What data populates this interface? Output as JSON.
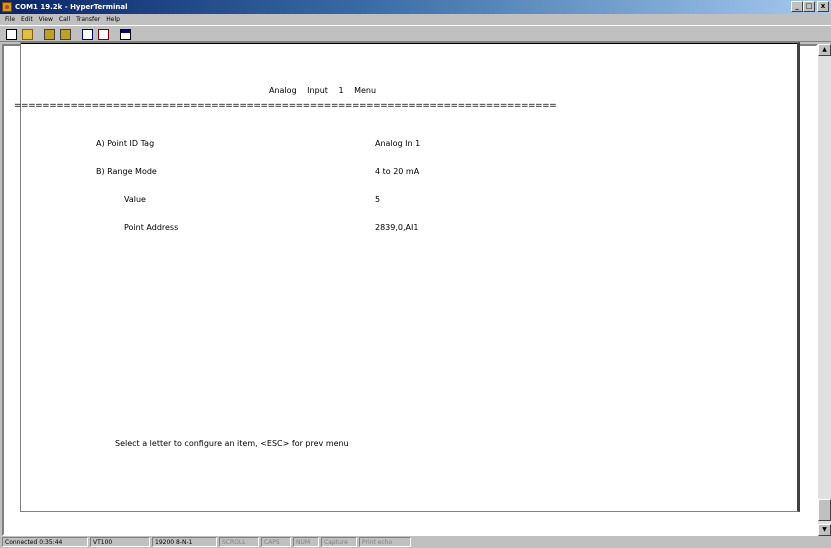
{
  "window": {
    "title": "COM1 19.2k - HyperTerminal",
    "controls": {
      "minimize": "_",
      "maximize": "□",
      "close": "x"
    }
  },
  "menu": {
    "items": [
      {
        "label": "File"
      },
      {
        "label": "Edit"
      },
      {
        "label": "View"
      },
      {
        "label": "Call"
      },
      {
        "label": "Transfer"
      },
      {
        "label": "Help"
      }
    ]
  },
  "toolbar": {
    "buttons": [
      {
        "icon": "new-file-icon"
      },
      {
        "icon": "open-icon"
      },
      {
        "icon": "call-icon"
      },
      {
        "icon": "disconnect-icon"
      },
      {
        "icon": "send-icon"
      },
      {
        "icon": "receive-icon"
      },
      {
        "icon": "properties-icon"
      }
    ]
  },
  "terminal": {
    "menu_title": "Analog Input 1 Menu",
    "rule": "=============================================================================",
    "rows": [
      {
        "label": "A) Point ID Tag",
        "value": "Analog In 1"
      },
      {
        "label": "B) Range Mode",
        "value": "4 to 20 mA"
      },
      {
        "label": "Value",
        "value": "5"
      },
      {
        "label": "Point Address",
        "value": "2839,0,AI1"
      }
    ],
    "prompt": "Select a letter to configure an item, <ESC> for prev menu"
  },
  "scrollbar": {
    "up_arrow": "▲",
    "down_arrow": "▼"
  },
  "status": {
    "connected": "Connected 0:35:44",
    "emulation": "VT100",
    "settings": "19200 8-N-1",
    "scroll": "SCROLL",
    "caps": "CAPS",
    "num": "NUM",
    "capture": "Capture",
    "print_echo": "Print echo"
  }
}
